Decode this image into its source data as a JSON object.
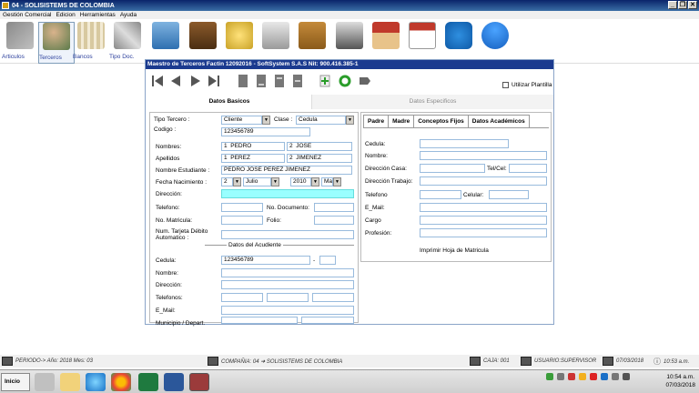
{
  "window": {
    "title": "04 - SOLISISTEMS DE COLOMBIA"
  },
  "menu": [
    "Gestión Comercial",
    "Edicion",
    "Herramientas",
    "Ayuda"
  ],
  "toolbar": {
    "items": [
      {
        "label": "Articulos",
        "icon": "articles-icon"
      },
      {
        "label": "Terceros",
        "icon": "people-icon"
      },
      {
        "label": "Bancos",
        "icon": "bank-icon"
      },
      {
        "label": "Tipo Doc.",
        "icon": "tools-icon"
      },
      {
        "label": "",
        "icon": "register-icon"
      },
      {
        "label": "",
        "icon": "chest-icon"
      },
      {
        "label": "",
        "icon": "coins-icon"
      },
      {
        "label": "",
        "icon": "calculator-icon"
      },
      {
        "label": "",
        "icon": "address-book-icon"
      },
      {
        "label": "",
        "icon": "printer-icon"
      },
      {
        "label": "",
        "icon": "house-icon"
      },
      {
        "label": "",
        "icon": "calendar-icon"
      },
      {
        "label": "",
        "icon": "teamviewer-icon"
      },
      {
        "label": "",
        "icon": "user-icon"
      }
    ]
  },
  "form": {
    "title": "Maestro de Terceros Factin 12092016 - SoftSystem S.A.S Nit: 900.416.385-1",
    "utilizar_plantilla": "Utilizar Plantilla",
    "tab_basic": "Datos Basicos",
    "tab_specific": "Datos Especificos",
    "labels": {
      "tipo_tercero": "Tipo Tercero :",
      "clase": "Clase :",
      "codigo": "Codigo :",
      "nombres": "Nombres:",
      "apellidos": "Apellidos",
      "nombre_estudiante": "Nombre Estudiante :",
      "fecha_nacimiento": "Fecha Nacimiento :",
      "direccion": "Dirección:",
      "telefono": "Telefono:",
      "no_documento": "No. Documento:",
      "no_matricula": "No. Matricula:",
      "folio": "Folio:",
      "num_tarjeta": "Num. Tarjeta Débito Automatico :",
      "datos_acudiente": "Datos del Acudiente",
      "cedula": "Cedula:",
      "nombre": "Nombre:",
      "direccion2": "Dirección:",
      "telefonos": "Telefonos:",
      "email": "E_Mail:",
      "municipio": "Municipio / Depart."
    },
    "values": {
      "tipo_tercero": "Cliente",
      "clase": "Cedula",
      "codigo": "123456789",
      "nombre1_num": "1",
      "nombre1": "PEDRO",
      "nombre2_num": "2",
      "nombre2": "JOSE",
      "apellido1_num": "1",
      "apellido1": "PEREZ",
      "apellido2_num": "2",
      "apellido2": "JIMENEZ",
      "nombre_estudiante": "PEDRO JOSE PEREZ JIMENEZ",
      "dia": "2",
      "mes": "Julio",
      "anio": "2010",
      "dia_semana": "Ma",
      "acudiente_cedula": "123456789",
      "acudiente_guion": "-"
    },
    "right": {
      "tabs": [
        "Padre",
        "Madre",
        "Conceptos Fijos",
        "Datos Académicos"
      ],
      "labels": {
        "cedula": "Cedula:",
        "nombre": "Nombre:",
        "direccion_casa": "Dirección Casa:",
        "tel_cel": "Tel/Cel:",
        "direccion_trabajo": "Dirección Trabajo:",
        "telefono": "Telefono",
        "celular": "Celular:",
        "email": "E_Mail:",
        "cargo": "Cargo",
        "profesion": "Profesión:",
        "imprimir": "Imprimir Hoja de Matricula"
      }
    }
  },
  "status": {
    "periodo": "PERIODO-> Año: 2018  Mes: 03",
    "compania": "COMPAÑIA: 04 ➜ SOLISISTEMS DE COLOMBIA",
    "caja": "CAJA: 001",
    "usuario": "USUARIO:SUPERVISOR",
    "fecha": "07/03/2018",
    "hora": "10:53 a.m."
  },
  "taskbar": {
    "start": "Inicio",
    "clock_time": "10:54 a.m.",
    "clock_date": "07/03/2018"
  }
}
